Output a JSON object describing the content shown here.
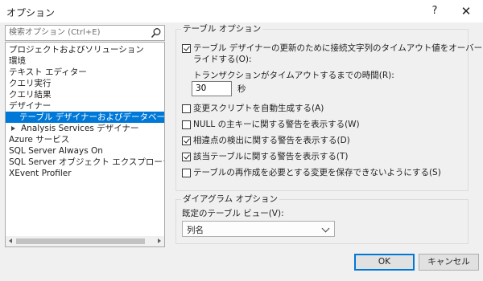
{
  "window": {
    "title": "オプション",
    "help": "?",
    "close": "✕"
  },
  "search": {
    "placeholder": "検索オプション (Ctrl+E)",
    "icon": "search-icon"
  },
  "tree": {
    "items": [
      {
        "label": "プロジェクトおよびソリューション"
      },
      {
        "label": "環境"
      },
      {
        "label": "テキスト エディター"
      },
      {
        "label": "クエリ実行"
      },
      {
        "label": "クエリ結果"
      },
      {
        "label": "デザイナー"
      },
      {
        "label": "テーブル デザイナーおよびデータベース デザイナー",
        "selected": true
      },
      {
        "label": "Analysis Services デザイナー",
        "collapsed": true
      },
      {
        "label": "Azure サービス"
      },
      {
        "label": "SQL Server Always On"
      },
      {
        "label": "SQL Server オブジェクト エクスプローラー"
      },
      {
        "label": "XEvent Profiler"
      }
    ]
  },
  "table_options": {
    "title": "テーブル オプション",
    "timeout_override": {
      "label_line1": "テーブル デザイナーの更新のために接続文字列のタイムアウト値をオーバー",
      "label_line2": "ライドする(O):",
      "checked": true
    },
    "timeout_label": "トランザクションがタイムアウトするまでの時間(R):",
    "timeout_value": "30",
    "timeout_unit": "秒",
    "options": [
      {
        "label": "変更スクリプトを自動生成する(A)",
        "checked": false
      },
      {
        "label": "NULL の主キーに関する警告を表示する(W)",
        "checked": false
      },
      {
        "label": "相違点の検出に関する警告を表示する(D)",
        "checked": true
      },
      {
        "label": "該当テーブルに関する警告を表示する(T)",
        "checked": true
      },
      {
        "label": "テーブルの再作成を必要とする変更を保存できないようにする(S)",
        "checked": false
      }
    ]
  },
  "diagram_options": {
    "title": "ダイアグラム オプション",
    "default_view_label": "既定のテーブル ビュー(V):",
    "default_view_value": "列名"
  },
  "buttons": {
    "ok": "OK",
    "cancel": "キャンセル"
  }
}
